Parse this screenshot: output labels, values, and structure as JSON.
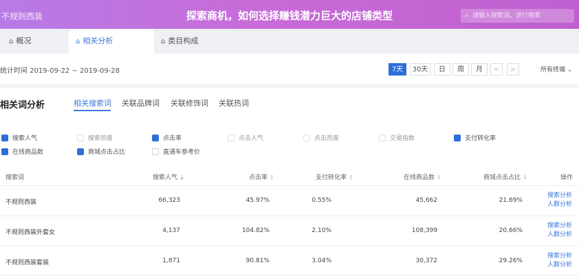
{
  "header": {
    "app_title": "不规则西装",
    "banner": "探索商机，如何选择赚钱潜力巨大的店铺类型",
    "search_placeholder": "请输入搜索词，进行搜索"
  },
  "tabs": [
    {
      "label": "概况"
    },
    {
      "label": "相关分析"
    },
    {
      "label": "类目构成"
    }
  ],
  "date_bar": {
    "stat_label": "统计时间 2019-09-22 ~ 2019-09-28",
    "ranges": [
      "7天",
      "30天",
      "日",
      "周",
      "月"
    ],
    "prev": "<",
    "next": ">",
    "terminal": "所有终端"
  },
  "panel": {
    "title": "相关词分析",
    "subtabs": [
      "相关搜索词",
      "关联品牌词",
      "关联修饰词",
      "关联热词"
    ],
    "checkboxes": [
      {
        "label": "搜索人气"
      },
      {
        "label": "搜索热度"
      },
      {
        "label": "点击率"
      },
      {
        "label": "点击人气"
      },
      {
        "label": "点击热度"
      },
      {
        "label": "交易指数"
      },
      {
        "label": "支付转化率"
      },
      {
        "label": "在线商品数"
      },
      {
        "label": "商城点击占比"
      },
      {
        "label": "直通车参考价"
      }
    ],
    "columns": [
      "搜索词",
      "搜索人气",
      "点击率",
      "支付转化率",
      "在线商品数",
      "商城点击占比",
      "操作"
    ],
    "rows": [
      {
        "term": "不规则西装",
        "popularity": "66,323",
        "ctr": "45.97%",
        "conversion": "0.55%",
        "products": "45,662",
        "mall_share": "21.69%",
        "op1": "搜索分析",
        "op2": "人群分析"
      },
      {
        "term": "不规则西装外套女",
        "popularity": "4,137",
        "ctr": "104.82%",
        "conversion": "2.10%",
        "products": "108,399",
        "mall_share": "20.66%",
        "op1": "搜索分析",
        "op2": "人群分析"
      },
      {
        "term": "不规则西装套装",
        "popularity": "1,871",
        "ctr": "90.81%",
        "conversion": "3.04%",
        "products": "30,372",
        "mall_share": "29.26%",
        "op1": "搜索分析",
        "op2": "人群分析"
      }
    ]
  }
}
